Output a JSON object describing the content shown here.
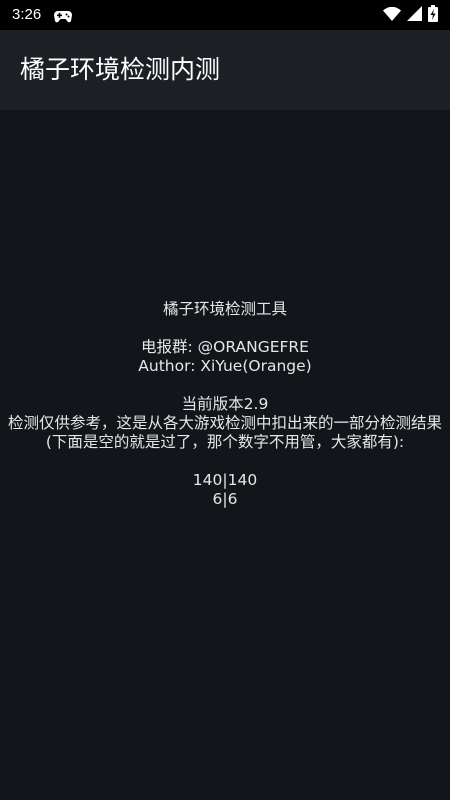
{
  "status_bar": {
    "time": "3:26",
    "icons": [
      "game-controller-icon",
      "wifi-icon",
      "signal-icon",
      "battery-icon"
    ]
  },
  "app_bar": {
    "title": "橘子环境检测内测"
  },
  "main": {
    "tool_name": "橘子环境检测工具",
    "telegram_group": "电报群: @ORANGEFRE",
    "author": "Author: XiYue(Orange)",
    "version": "当前版本2.9",
    "disclaimer": "检测仅供参考，这是从各大游戏检测中扣出来的一部分检测结果(下面是空的就是过了，那个数字不用管，大家都有):",
    "result_1": "140|140",
    "result_2": "6|6"
  },
  "colors": {
    "status_bar_bg": "#000000",
    "app_bar_bg": "#1c2025",
    "content_bg": "#121519",
    "text": "#e6e6e6"
  }
}
